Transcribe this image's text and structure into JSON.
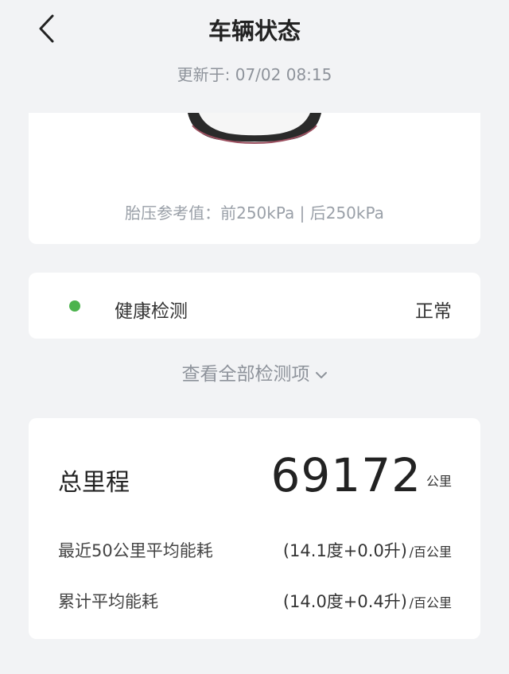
{
  "header": {
    "title": "车辆状态",
    "updated": "更新于: 07/02 08:15"
  },
  "tire": {
    "reference": "胎压参考值：前250kPa | 后250kPa"
  },
  "health": {
    "label": "健康检测",
    "status": "正常",
    "status_color": "#4cb34d"
  },
  "view_all": {
    "label": "查看全部检测项"
  },
  "mileage": {
    "total_label": "总里程",
    "total_value": "69172",
    "total_unit": "公里",
    "rows": [
      {
        "label": "最近50公里平均能耗",
        "value": "(14.1度+0.0升)",
        "unit": "/百公里"
      },
      {
        "label": "累计平均能耗",
        "value": "(14.0度+0.4升)",
        "unit": "/百公里"
      }
    ]
  },
  "icons": {
    "back": "chevron-left-icon",
    "expand": "chevron-down-icon"
  }
}
